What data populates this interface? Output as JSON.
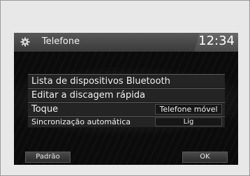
{
  "header": {
    "title": "Telefone",
    "time": "12:34",
    "icon": "gear-icon"
  },
  "menu": {
    "items": [
      {
        "label": "Lista de dispositivos Bluetooth"
      },
      {
        "label": "Editar a discagem rápida"
      },
      {
        "label": "Toque",
        "value": "Telefone móvel"
      },
      {
        "label": "Sincronização automática",
        "value": "Lig"
      }
    ]
  },
  "footer": {
    "default_label": "Padrão",
    "ok_label": "OK"
  },
  "colors": {
    "screen_bg": "#0b0b0b",
    "titlebar": "#4a4a4a",
    "text": "#f0f0f0"
  }
}
